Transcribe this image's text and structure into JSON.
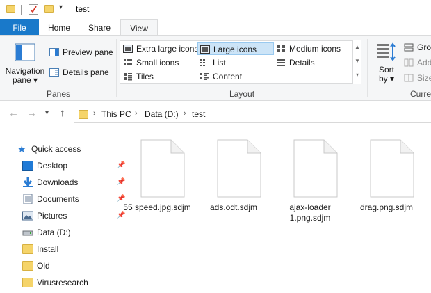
{
  "window": {
    "title": "test"
  },
  "ribbon_tabs": [
    {
      "label": "File"
    },
    {
      "label": "Home"
    },
    {
      "label": "Share"
    },
    {
      "label": "View"
    }
  ],
  "panes": {
    "navigation_pane_line1": "Navigation",
    "navigation_pane_line2": "pane",
    "preview_pane": "Preview pane",
    "details_pane": "Details pane",
    "group_label": "Panes"
  },
  "layout": {
    "extra_large_icons": "Extra large icons",
    "large_icons": "Large icons",
    "medium_icons": "Medium icons",
    "small_icons": "Small icons",
    "list": "List",
    "details": "Details",
    "tiles": "Tiles",
    "content": "Content",
    "group_label": "Layout",
    "selected": "Large icons"
  },
  "current_view": {
    "sort_line1": "Sort",
    "sort_line2": "by",
    "group_by": "Grou",
    "add_columns": "Add",
    "size_columns": "Size",
    "group_label": "Curren"
  },
  "breadcrumb": [
    "This PC",
    "Data (D:)",
    "test"
  ],
  "sidebar": {
    "quick_access": "Quick access",
    "items": [
      {
        "label": "Desktop",
        "pinned": true
      },
      {
        "label": "Downloads",
        "pinned": true
      },
      {
        "label": "Documents",
        "pinned": true
      },
      {
        "label": "Pictures",
        "pinned": true
      },
      {
        "label": "Data (D:)",
        "pinned": false
      },
      {
        "label": "Install",
        "pinned": false
      },
      {
        "label": "Old",
        "pinned": false
      },
      {
        "label": "Virusresearch",
        "pinned": false
      }
    ]
  },
  "files": [
    {
      "name": "55 speed.jpg.sdjm"
    },
    {
      "name": "ads.odt.sdjm"
    },
    {
      "name": "ajax-loader 1.png.sdjm"
    },
    {
      "name": "drag.png.sdjm"
    }
  ],
  "colors": {
    "file_tab": "#1979ca",
    "selection": "#cce4f7",
    "folder": "#f5d46a"
  }
}
